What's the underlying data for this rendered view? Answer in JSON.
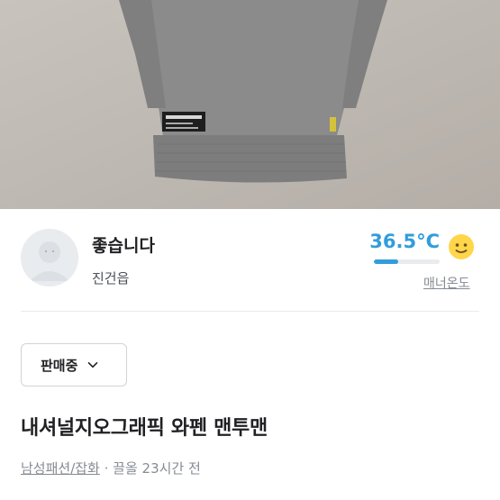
{
  "seller": {
    "nickname": "좋습니다",
    "region": "진건읍",
    "manner_temperature": "36.5°C",
    "manner_temperature_level": 0.365,
    "manner_label": "매너온도"
  },
  "status_select": {
    "label": "판매중",
    "icon": "chevron-down-icon"
  },
  "post": {
    "title": "내셔널지오그래픽 와펜 맨투맨",
    "category": "남성패션/잡화",
    "separator": " · ",
    "time": "끌올 23시간 전"
  },
  "colors": {
    "accent": "#319ddc",
    "text_primary": "#212124",
    "text_secondary": "#868b94"
  }
}
